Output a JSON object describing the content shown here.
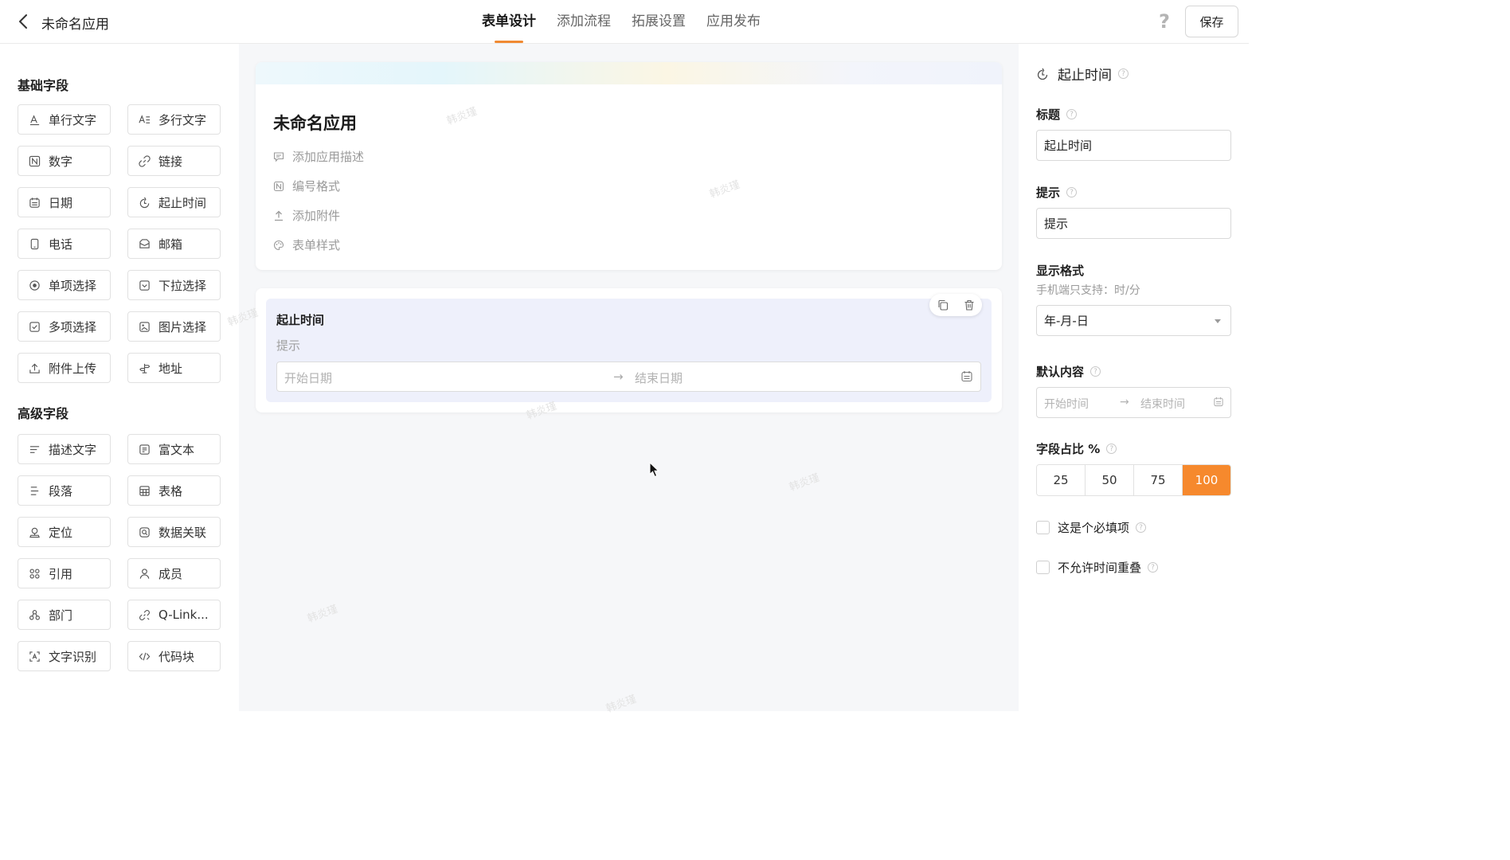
{
  "header": {
    "app_title": "未命名应用",
    "tabs": [
      {
        "label": "表单设计",
        "active": true
      },
      {
        "label": "添加流程",
        "active": false
      },
      {
        "label": "拓展设置",
        "active": false
      },
      {
        "label": "应用发布",
        "active": false
      }
    ],
    "help_icon": "?",
    "save_label": "保存",
    "accent_color": "#f08a32"
  },
  "left_panel": {
    "basic_title": "基础字段",
    "basic_fields": [
      {
        "label": "单行文字",
        "icon": "single-line-text-icon"
      },
      {
        "label": "多行文字",
        "icon": "multi-line-text-icon"
      },
      {
        "label": "数字",
        "icon": "number-icon"
      },
      {
        "label": "链接",
        "icon": "link-icon"
      },
      {
        "label": "日期",
        "icon": "calendar-icon"
      },
      {
        "label": "起止时间",
        "icon": "time-range-icon"
      },
      {
        "label": "电话",
        "icon": "phone-icon"
      },
      {
        "label": "邮箱",
        "icon": "mail-icon"
      },
      {
        "label": "单项选择",
        "icon": "radio-icon"
      },
      {
        "label": "下拉选择",
        "icon": "dropdown-icon"
      },
      {
        "label": "多项选择",
        "icon": "checkbox-icon"
      },
      {
        "label": "图片选择",
        "icon": "image-icon"
      },
      {
        "label": "附件上传",
        "icon": "upload-icon"
      },
      {
        "label": "地址",
        "icon": "address-icon"
      }
    ],
    "advanced_title": "高级字段",
    "advanced_fields": [
      {
        "label": "描述文字",
        "icon": "description-icon"
      },
      {
        "label": "富文本",
        "icon": "rich-text-icon"
      },
      {
        "label": "段落",
        "icon": "paragraph-icon"
      },
      {
        "label": "表格",
        "icon": "table-icon"
      },
      {
        "label": "定位",
        "icon": "location-icon"
      },
      {
        "label": "数据关联",
        "icon": "data-link-icon"
      },
      {
        "label": "引用",
        "icon": "reference-icon"
      },
      {
        "label": "成员",
        "icon": "member-icon"
      },
      {
        "label": "部门",
        "icon": "department-icon"
      },
      {
        "label": "Q-Link...",
        "icon": "q-link-icon"
      },
      {
        "label": "文字识别",
        "icon": "ocr-icon"
      },
      {
        "label": "代码块",
        "icon": "code-icon"
      }
    ]
  },
  "canvas": {
    "form_title": "未命名应用",
    "meta_items": [
      {
        "label": "添加应用描述",
        "icon": "comment-icon"
      },
      {
        "label": "编号格式",
        "icon": "number-format-icon"
      },
      {
        "label": "添加附件",
        "icon": "upload-icon"
      },
      {
        "label": "表单样式",
        "icon": "palette-icon"
      }
    ],
    "selected_field": {
      "title": "起止时间",
      "hint": "提示",
      "start_placeholder": "开始日期",
      "end_placeholder": "结束日期",
      "arrow": "→"
    },
    "watermark": "韩炎瑾"
  },
  "right_panel": {
    "heading": "起止时间",
    "title_label": "标题",
    "title_value": "起止时间",
    "hint_label": "提示",
    "hint_value": "提示",
    "format_label": "显示格式",
    "format_sub": "手机端只支持：时/分",
    "format_value": "年-月-日",
    "default_label": "默认内容",
    "default_start": "开始时间",
    "default_arrow": "→",
    "default_end": "结束时间",
    "ratio_label": "字段占比 %",
    "ratio_options": [
      "25",
      "50",
      "75",
      "100"
    ],
    "ratio_selected": "100",
    "required_label": "这是个必填项",
    "no_overlap_label": "不允许时间重叠"
  }
}
